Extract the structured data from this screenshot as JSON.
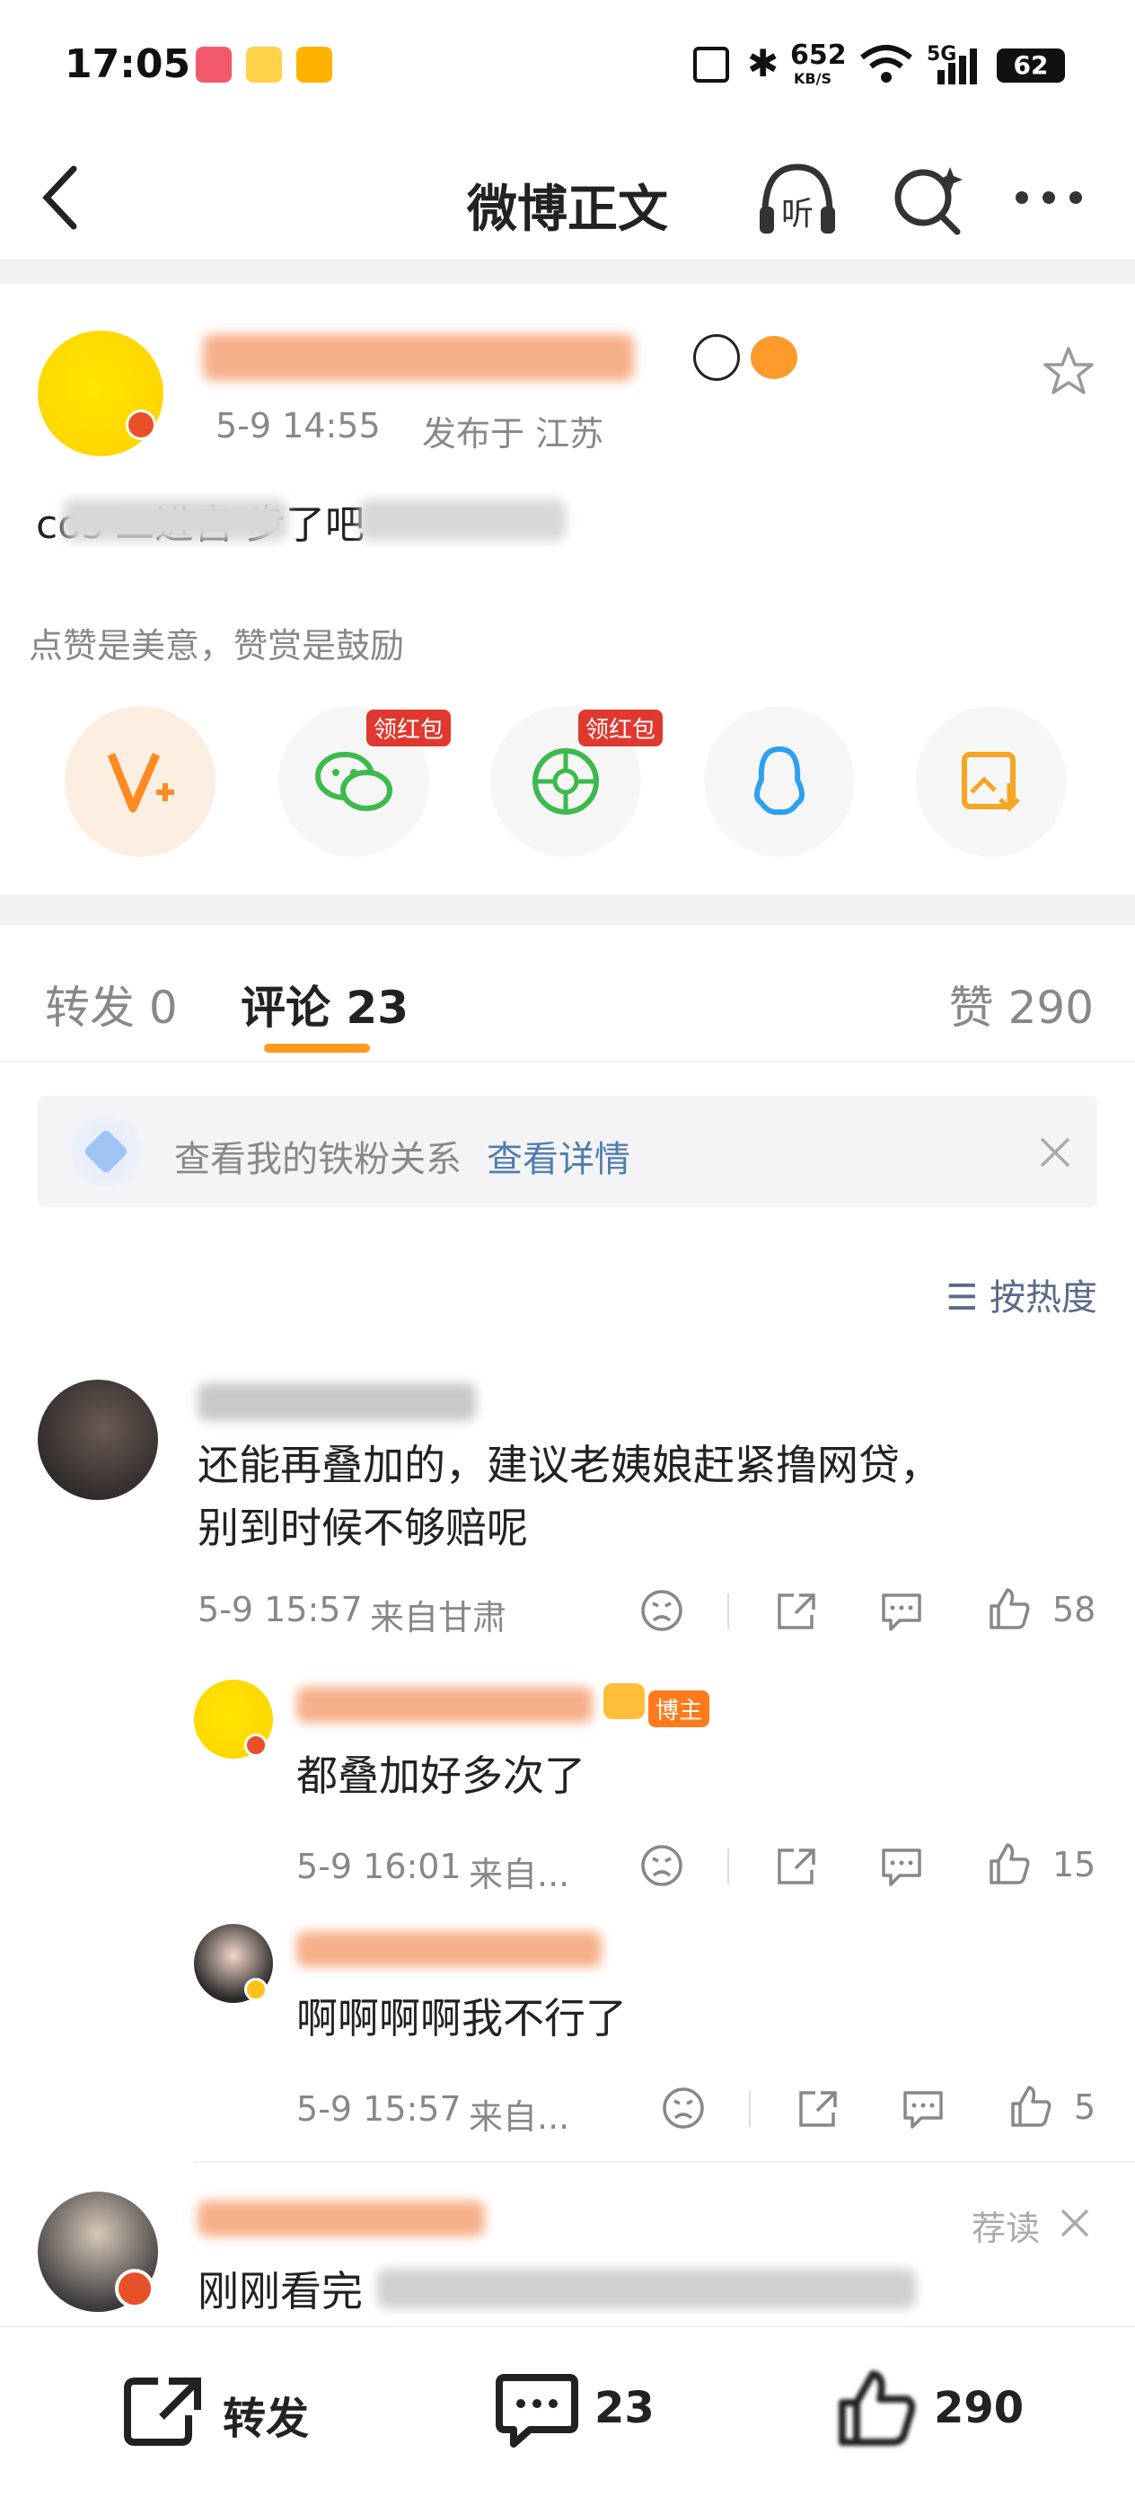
{
  "status_bar": {
    "time": "17:05",
    "net_speed": "652",
    "net_unit": "KB/S",
    "network": "5G",
    "battery": "62"
  },
  "nav": {
    "title": "微博正文"
  },
  "post": {
    "meta_time": "5-9 14:55",
    "meta_location": "发布于 江苏",
    "text": "cos 二进宫 步了吧",
    "slogan": "点赞是美意，赞赏是鼓励",
    "red_packet_label": "领红包"
  },
  "tabs": {
    "repost": "转发 0",
    "comments": "评论 23",
    "likes": "赞 290"
  },
  "iron_fans": {
    "text": "查看我的铁粉关系",
    "link": "查看详情"
  },
  "sort": {
    "label": "按热度"
  },
  "comments": [
    {
      "text_line1": "还能再叠加的，建议老姨娘赶紧撸网贷，",
      "text_line2": "别到时候不够赔呢",
      "time": "5-9 15:57",
      "location": "来自甘肃",
      "likes": "58",
      "replies": [
        {
          "badge": "博主",
          "text": "都叠加好多次了",
          "time": "5-9 16:01",
          "location": "来自...",
          "likes": "15"
        },
        {
          "text": "啊啊啊啊我不行了",
          "time": "5-9 15:57",
          "location": "来自...",
          "likes": "5"
        }
      ]
    },
    {
      "text": "刚刚看完",
      "recommend": "荐读"
    }
  ],
  "bottom_bar": {
    "repost": "转发",
    "comments": "23",
    "likes": "290"
  },
  "colors": {
    "accent": "#ff8200",
    "link": "#507daf",
    "tab_underline": "#ff9a1f"
  }
}
